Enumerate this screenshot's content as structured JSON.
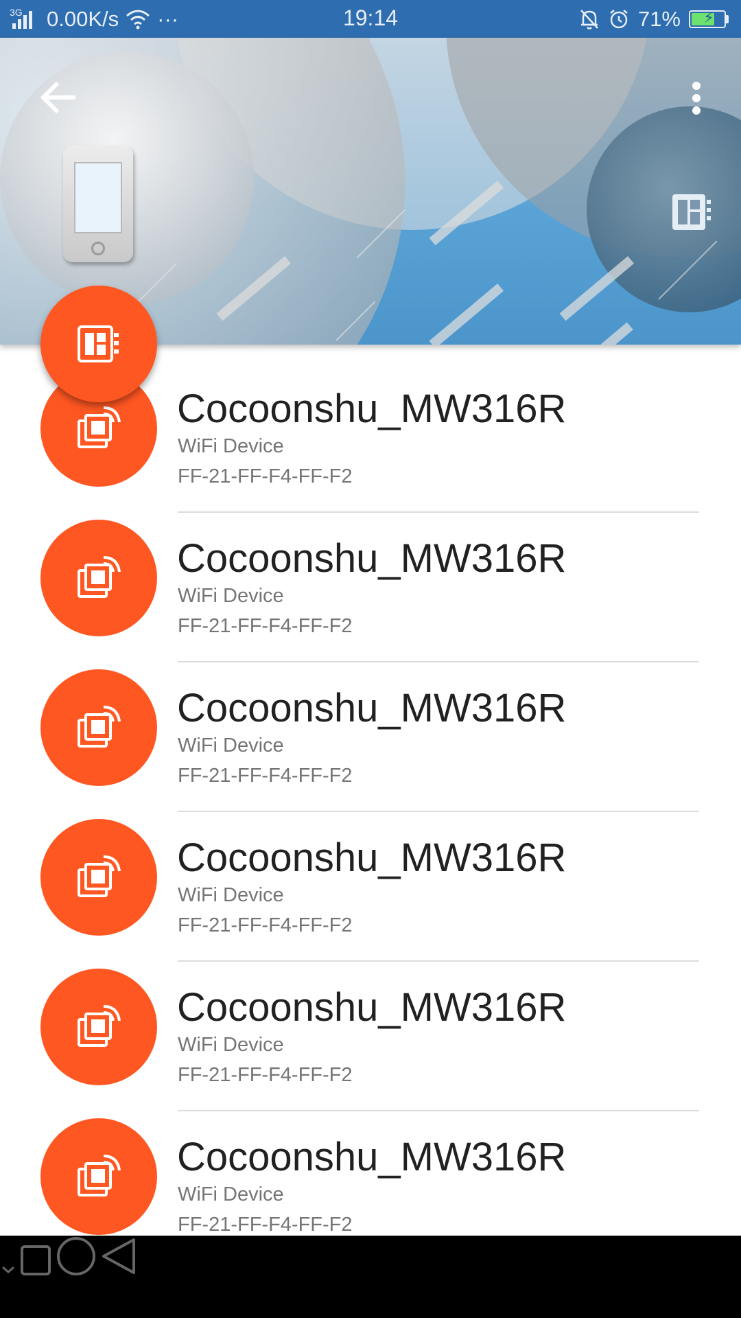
{
  "status_bar": {
    "network_type": "3G",
    "speed": "0.00K/s",
    "more_dots": "···",
    "time": "19:14",
    "battery_percent": "71%",
    "battery_level": 0.71
  },
  "header": {
    "back_icon": "arrow-left-icon",
    "more_icon": "more-vert-icon",
    "device_icon": "smartphone-icon",
    "chip_icon": "chip-icon"
  },
  "fab": {
    "icon": "chip-icon",
    "color": "#ff5722"
  },
  "devices": [
    {
      "name": "Cocoonshu_MW316R",
      "type": "WiFi Device",
      "mac": "FF-21-FF-F4-FF-F2"
    },
    {
      "name": "Cocoonshu_MW316R",
      "type": "WiFi Device",
      "mac": "FF-21-FF-F4-FF-F2"
    },
    {
      "name": "Cocoonshu_MW316R",
      "type": "WiFi Device",
      "mac": "FF-21-FF-F4-FF-F2"
    },
    {
      "name": "Cocoonshu_MW316R",
      "type": "WiFi Device",
      "mac": "FF-21-FF-F4-FF-F2"
    },
    {
      "name": "Cocoonshu_MW316R",
      "type": "WiFi Device",
      "mac": "FF-21-FF-F4-FF-F2"
    },
    {
      "name": "Cocoonshu_MW316R",
      "type": "WiFi Device",
      "mac": "FF-21-FF-F4-FF-F2"
    }
  ],
  "nav_bar": {
    "collapse_icon": "chevron-down-icon",
    "recents_icon": "square-icon",
    "home_icon": "circle-icon",
    "back_icon": "triangle-back-icon"
  },
  "colors": {
    "accent": "#ff5722",
    "status_bar": "#2e6db0",
    "header_blue": "#5aa3d6"
  }
}
